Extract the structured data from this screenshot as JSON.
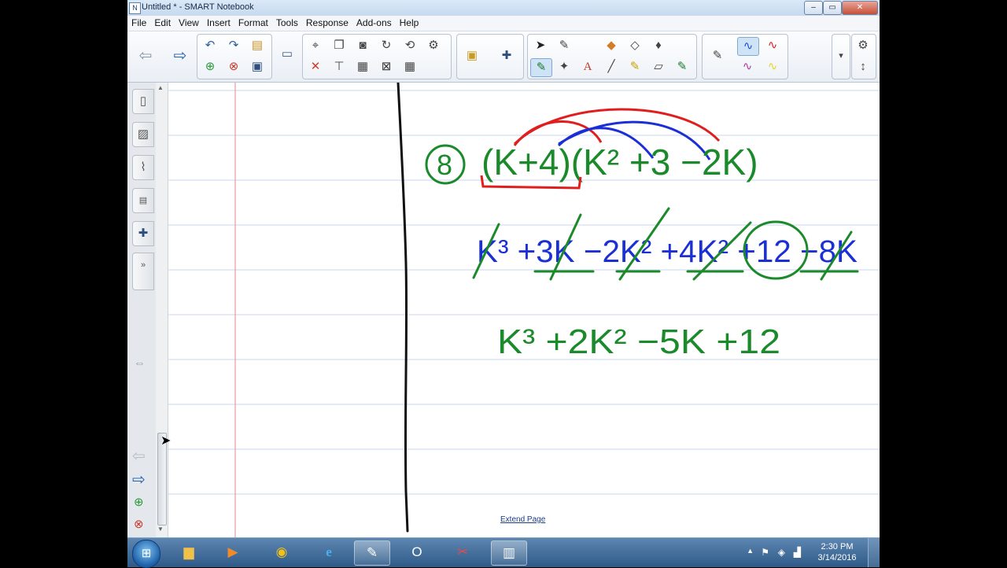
{
  "window": {
    "title": "Untitled * - SMART Notebook"
  },
  "menu": [
    "File",
    "Edit",
    "View",
    "Insert",
    "Format",
    "Tools",
    "Response",
    "Add-ons",
    "Help"
  ],
  "canvas": {
    "extend_link": "Extend Page",
    "problem_number": "8",
    "line1": "(K+4)(K² +3 −2K)",
    "line2": "K³ +3K −2K² +4K² +12 −8K",
    "line3": "K³ +2K² −5K +12"
  },
  "colors": {
    "green_ink": "#1a8a2a",
    "blue_ink": "#1b2fd6",
    "red_ink": "#e01e1e",
    "margin_line": "#e08a8a",
    "rule_line": "#c9d6ee"
  },
  "taskbar": {
    "time": "2:30 PM",
    "date": "3/14/2016"
  }
}
